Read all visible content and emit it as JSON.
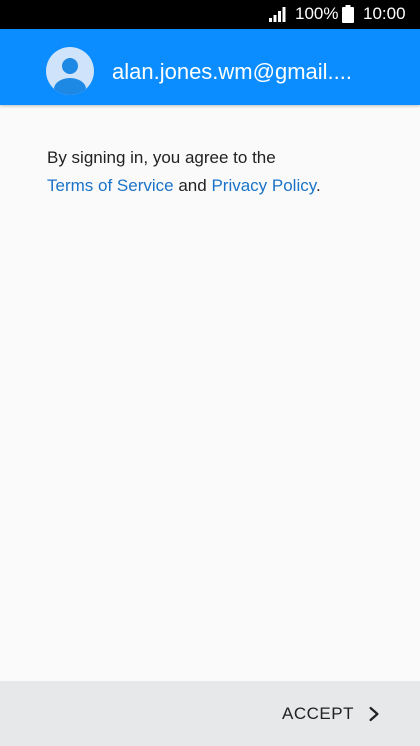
{
  "status_bar": {
    "battery_percent": "100%",
    "time": "10:00",
    "icons": [
      "signal-icon",
      "battery-icon"
    ]
  },
  "account": {
    "email": "alan.jones.wm@gmail....",
    "avatar_icon": "person-avatar-icon"
  },
  "consent": {
    "intro": "By signing in, you agree to the",
    "terms_link": "Terms of Service",
    "and": "and",
    "privacy_link": "Privacy Policy",
    "period": "."
  },
  "footer": {
    "accept_label": "ACCEPT",
    "accept_icon": "chevron-right-icon"
  },
  "colors": {
    "header_bg": "#0c8dff",
    "link": "#1a73c8",
    "footer_bg": "#e6e8ea",
    "page_bg": "#fafafa"
  }
}
